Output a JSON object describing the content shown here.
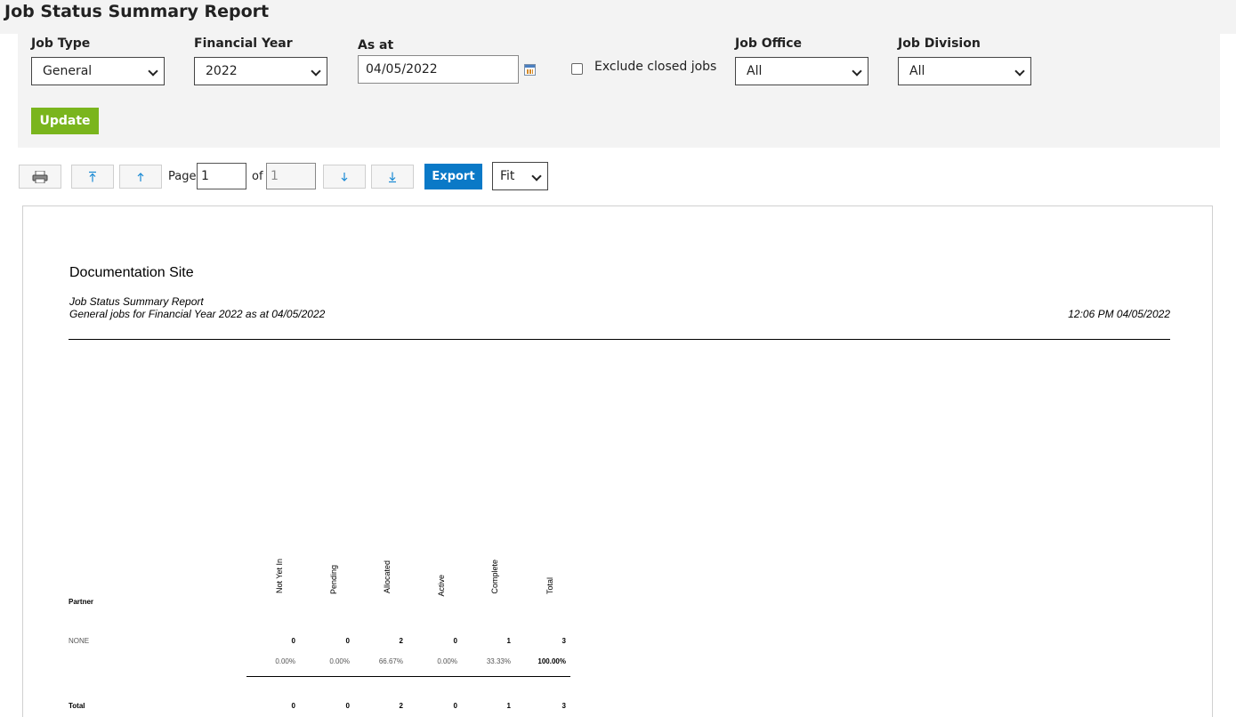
{
  "page": {
    "title": "Job Status Summary Report"
  },
  "filters": {
    "job_type": {
      "label": "Job Type",
      "value": "General"
    },
    "financial_year": {
      "label": "Financial Year",
      "value": "2022"
    },
    "as_at": {
      "label": "As at",
      "value": "04/05/2022"
    },
    "exclude_closed": {
      "label": "Exclude closed jobs",
      "checked": false
    },
    "job_office": {
      "label": "Job Office",
      "value": "All"
    },
    "job_division": {
      "label": "Job Division",
      "value": "All"
    },
    "update_label": "Update"
  },
  "toolbar": {
    "page_label": "Page",
    "of_label": "of",
    "current_page": "1",
    "total_pages": "1",
    "export_label": "Export",
    "zoom_value": "Fit",
    "icons": [
      "printer-icon",
      "first-page-icon",
      "previous-page-icon",
      "next-page-icon",
      "last-page-icon"
    ]
  },
  "report": {
    "site_name": "Documentation Site",
    "title": "Job Status Summary Report",
    "subtitle": "General jobs for Financial Year 2022 as at 04/05/2022",
    "timestamp": "12:06 PM 04/05/2022",
    "table": {
      "row_header": "Partner",
      "columns": [
        "Not Yet In",
        "Pending",
        "Allocated",
        "Active",
        "Complete",
        "Total"
      ],
      "rows": [
        {
          "label": "NONE",
          "counts": [
            "0",
            "0",
            "2",
            "0",
            "1",
            "3"
          ],
          "percents": [
            "0.00%",
            "0.00%",
            "66.67%",
            "0.00%",
            "33.33%",
            "100.00%"
          ]
        }
      ],
      "total": {
        "label": "Total",
        "counts": [
          "0",
          "0",
          "2",
          "0",
          "1",
          "3"
        ]
      }
    }
  },
  "colors": {
    "update_button": "#7ab51d",
    "export_button": "#0a79c7",
    "panel_bg": "#f3f3f3",
    "arrow_icon": "#1a8ad4"
  }
}
